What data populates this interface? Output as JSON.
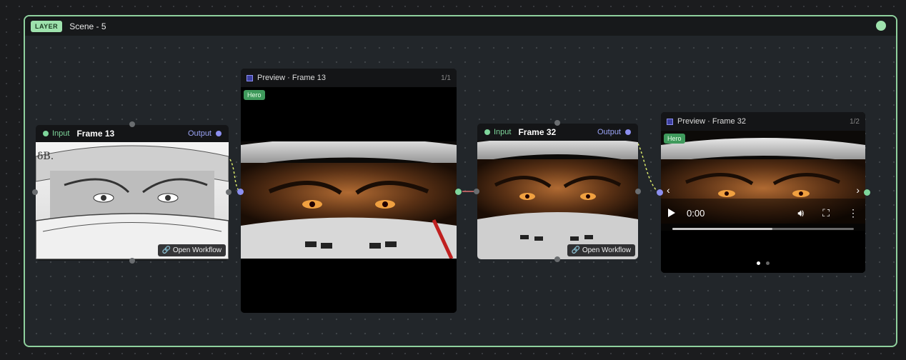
{
  "layer": {
    "badge": "LAYER",
    "title": "Scene - 5"
  },
  "node1": {
    "input_label": "Input",
    "title": "Frame 13",
    "output_label": "Output",
    "open_workflow": "Open Workflow"
  },
  "preview1": {
    "title": "Preview · Frame 13",
    "count": "1/1",
    "badge": "Hero"
  },
  "node2": {
    "input_label": "Input",
    "title": "Frame 32",
    "output_label": "Output",
    "open_workflow": "Open Workflow"
  },
  "preview2": {
    "title": "Preview · Frame 32",
    "count": "1/2",
    "badge": "Hero",
    "video": {
      "time": "0:00",
      "progress": 0.55
    },
    "prev_arrow": "‹",
    "next_arrow": "›",
    "pages": 2,
    "current_page": 1
  },
  "colors": {
    "accent_green": "#8fd19e",
    "port_blue": "#8c8ff0",
    "hero_green": "#3f9a5c"
  },
  "icons": {
    "link": "link-icon",
    "play": "play-icon",
    "volume": "volume-icon",
    "fullscreen": "fullscreen-icon",
    "more": "more-vert-icon"
  }
}
